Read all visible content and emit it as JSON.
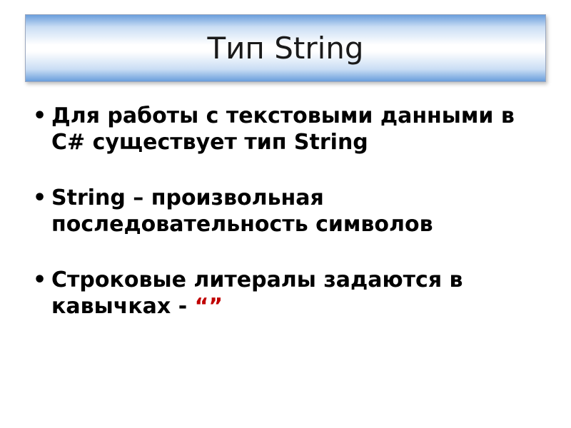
{
  "title": "Тип String",
  "bullets": [
    {
      "text": "Для работы с текстовыми данными в C# существует тип String"
    },
    {
      "text": "String – произвольная последовательность символов"
    },
    {
      "prefix": "Строковые литералы задаются в кавычках - ",
      "quote": "“”"
    }
  ]
}
